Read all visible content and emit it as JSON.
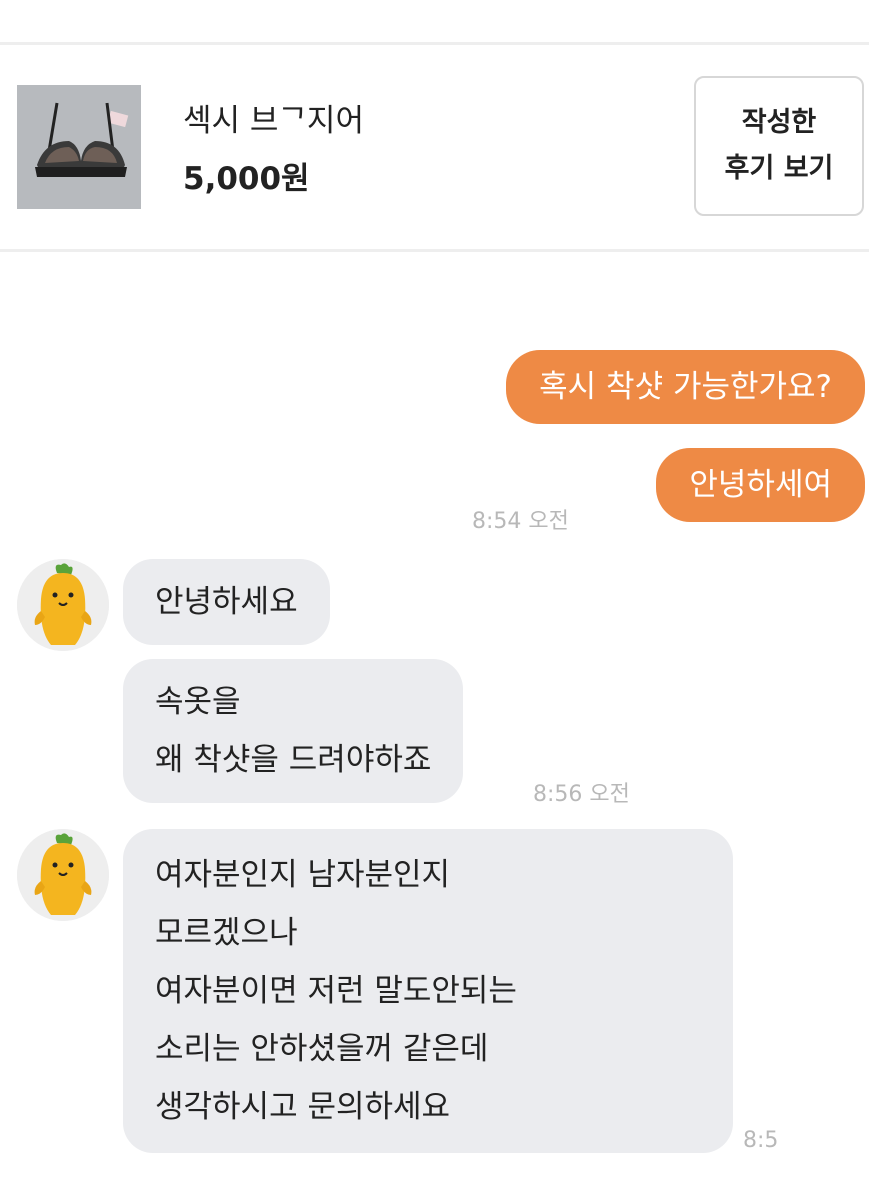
{
  "product": {
    "name": "섹시 브ᄀ지어",
    "price": "5,000원",
    "review_button": {
      "line1": "작성한",
      "line2": "후기 보기"
    }
  },
  "messages": {
    "sent_1": "혹시 착샷 가능한가요?",
    "sent_2": "안녕하세여",
    "sent_time": "8:54 오전",
    "recv_1": "안녕하세요",
    "recv_2": [
      "속옷을",
      "왜 착샷을 드려야하죠"
    ],
    "recv_time_1": "8:56 오전",
    "recv_3": [
      "여자분인지 남자분인지",
      "모르겠으나",
      "여자분이면 저런 말도안되는",
      "소리는 안하셨을꺼 같은데",
      "생각하시고 문의하세요"
    ],
    "recv_time_2": "8:5"
  },
  "colors": {
    "sent_bubble": "#ee8a45",
    "received_bubble": "#ebecef",
    "timestamp": "#b8b8b8"
  },
  "icons": {
    "avatar": "carrot-character-avatar",
    "product_image": "bra-product-thumbnail"
  }
}
